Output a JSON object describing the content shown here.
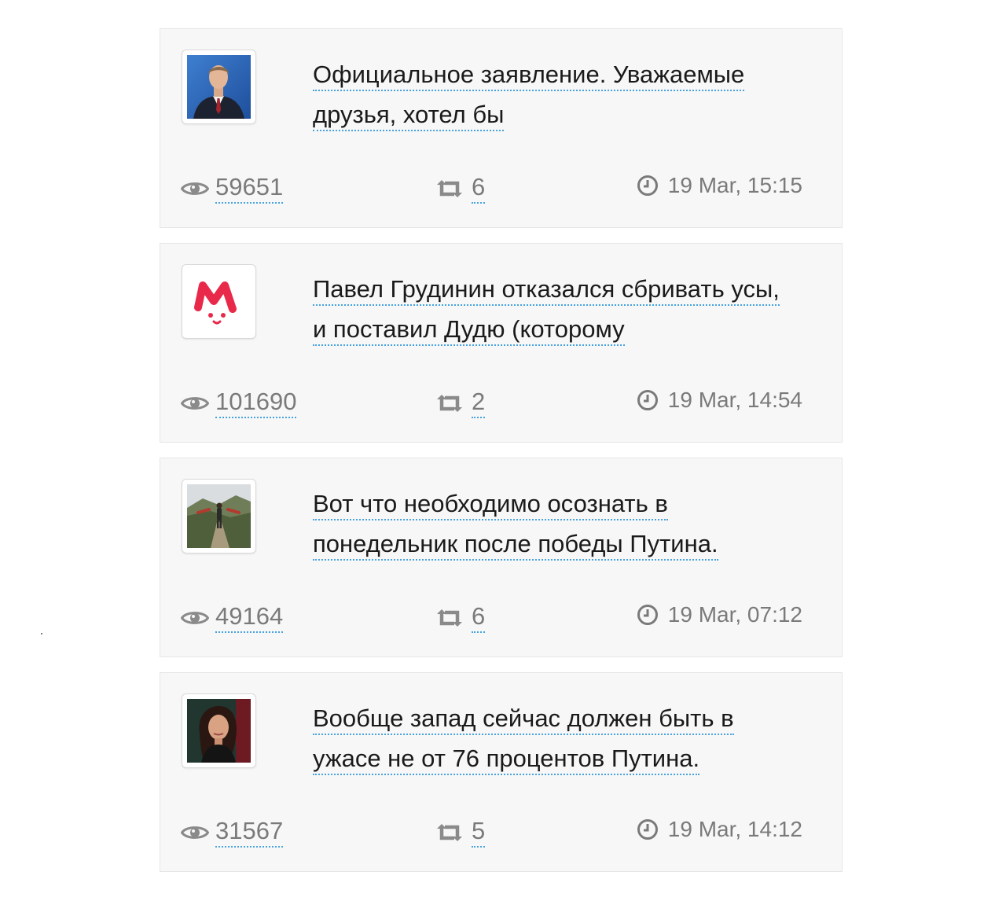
{
  "posts": [
    {
      "avatar": "politician-in-suit-avatar",
      "text": "Официальное заявление. Уважаемые друзья, хотел бы",
      "views": "59651",
      "reposts": "6",
      "time": "19 Mar, 15:15"
    },
    {
      "avatar": "red-m-logo-avatar",
      "text": "Павел Грудинин отказался сбривать усы, и поставил Дудю (которому",
      "views": "101690",
      "reposts": "2",
      "time": "19 Mar, 14:54"
    },
    {
      "avatar": "hiker-on-path-avatar",
      "text": "Вот что необходимо осознать в понедельник после победы Путина.",
      "views": "49164",
      "reposts": "6",
      "time": "19 Mar, 07:12"
    },
    {
      "avatar": "woman-portrait-avatar",
      "text": "Вообще запад сейчас должен быть в ужасе не от 76 процентов Путина.",
      "views": "31567",
      "reposts": "5",
      "time": "19 Mar, 14:12"
    }
  ],
  "icons": {
    "views": "eye-icon",
    "reposts": "repost-icon",
    "time": "clock-icon"
  },
  "colors": {
    "card_bg": "#f7f7f7",
    "link_underline": "#47a3df",
    "meta_text": "#7a7a7a",
    "brand_red": "#e8294a"
  }
}
